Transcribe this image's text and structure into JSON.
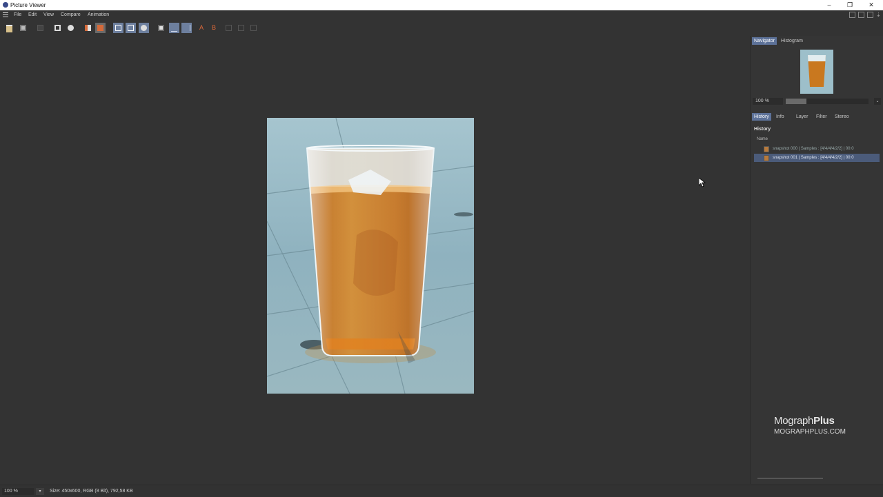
{
  "window": {
    "title": "Picture Viewer",
    "controls": {
      "minimize": "–",
      "restore": "❐",
      "close": "✕"
    }
  },
  "menu": {
    "items": [
      "File",
      "Edit",
      "View",
      "Compare",
      "Animation"
    ]
  },
  "toolbar": {
    "icons": [
      "open-icon",
      "save-icon",
      "render-region-icon",
      "crop-icon",
      "stop-render-icon",
      "filter-icon",
      "layer-icon",
      "ab-compare-a-icon",
      "ab-compare-b-icon",
      "ab-swap-icon",
      "snapshot-icon",
      "split-horizontal-icon",
      "split-vertical-icon",
      "set-a-icon",
      "set-b-icon",
      "fit-icon",
      "full-view-icon",
      "magnify-icon"
    ]
  },
  "navigator": {
    "tabs": [
      "Navigator",
      "Histogram"
    ],
    "active_tab": "Navigator",
    "zoom": "100 %",
    "zoom_slider_fraction": 0.25
  },
  "history_panel": {
    "tabs": [
      "History",
      "Info",
      "Layer",
      "Filter",
      "Stereo"
    ],
    "active_tab": "History",
    "heading": "History",
    "column_name": "Name",
    "rows": [
      {
        "text": "snapshot 000  |  Samples : [4/4/4/4/2/2]  |  00:0",
        "selected": false
      },
      {
        "text": "snapshot 001  |  Samples : [4/4/4/4/2/2]  |  00:0",
        "selected": true
      }
    ]
  },
  "branding": {
    "line1_regular": "Mograph",
    "line1_bold": "Plus",
    "line2": "MOGRAPHPLUS.COM"
  },
  "status": {
    "zoom": "100 %",
    "dropdown": "▾",
    "info": "Size: 450x600, RGB (8 Bit), 792,58 KB"
  },
  "colors": {
    "background": "#333333",
    "accent_tab": "#5d7299",
    "liquid": "#c9781f",
    "floor": "#8fb4c2"
  }
}
